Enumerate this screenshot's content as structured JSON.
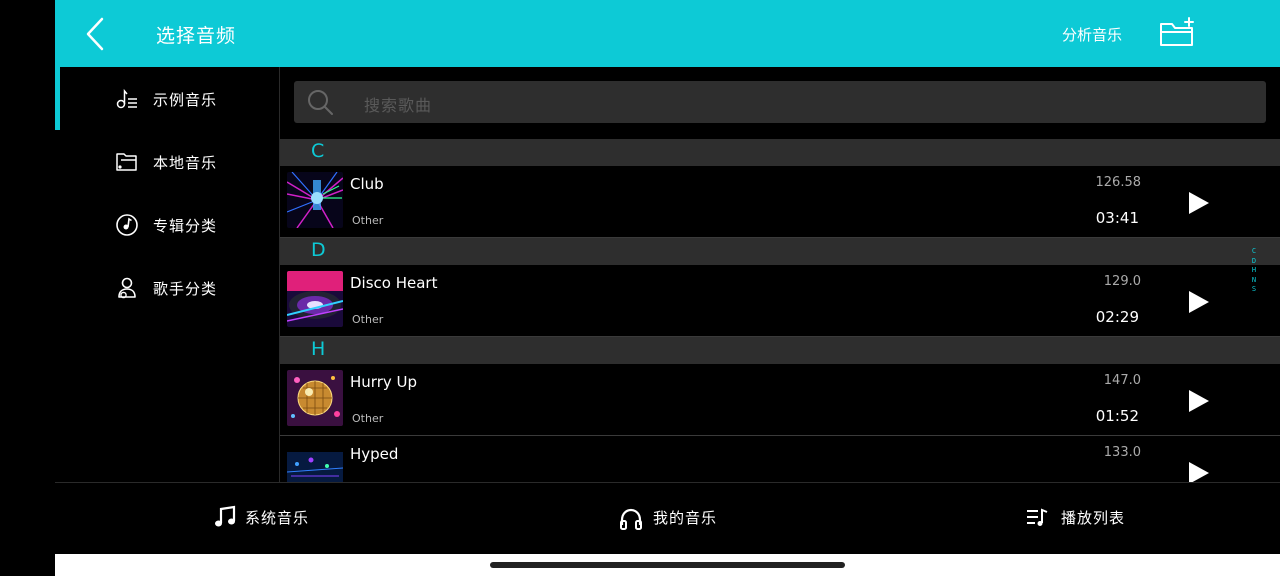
{
  "header": {
    "title": "选择音频",
    "analyze_label": "分析音乐",
    "accent_color": "#0dcad6"
  },
  "sidebar": {
    "items": [
      {
        "label": "示例音乐",
        "icon": "music-sample-icon",
        "selected": true
      },
      {
        "label": "本地音乐",
        "icon": "local-folder-icon",
        "selected": false
      },
      {
        "label": "专辑分类",
        "icon": "album-disc-icon",
        "selected": false
      },
      {
        "label": "歌手分类",
        "icon": "singer-icon",
        "selected": false
      }
    ]
  },
  "search": {
    "placeholder": "搜索歌曲"
  },
  "sections": [
    {
      "letter": "C",
      "songs": [
        {
          "name": "Club",
          "category": "Other",
          "bpm": "126.58",
          "duration": "03:41"
        }
      ]
    },
    {
      "letter": "D",
      "songs": [
        {
          "name": "Disco Heart",
          "category": "Other",
          "bpm": "129.0",
          "duration": "02:29"
        }
      ]
    },
    {
      "letter": "H",
      "songs": [
        {
          "name": "Hurry Up",
          "category": "Other",
          "bpm": "147.0",
          "duration": "01:52"
        },
        {
          "name": "Hyped",
          "category": "",
          "bpm": "133.0",
          "duration": ""
        }
      ]
    }
  ],
  "alpha_index": [
    "C",
    "D",
    "H",
    "N",
    "S"
  ],
  "tabs": [
    {
      "label": "系统音乐",
      "icon": "music-note-icon"
    },
    {
      "label": "我的音乐",
      "icon": "headphones-icon"
    },
    {
      "label": "播放列表",
      "icon": "playlist-icon"
    }
  ]
}
